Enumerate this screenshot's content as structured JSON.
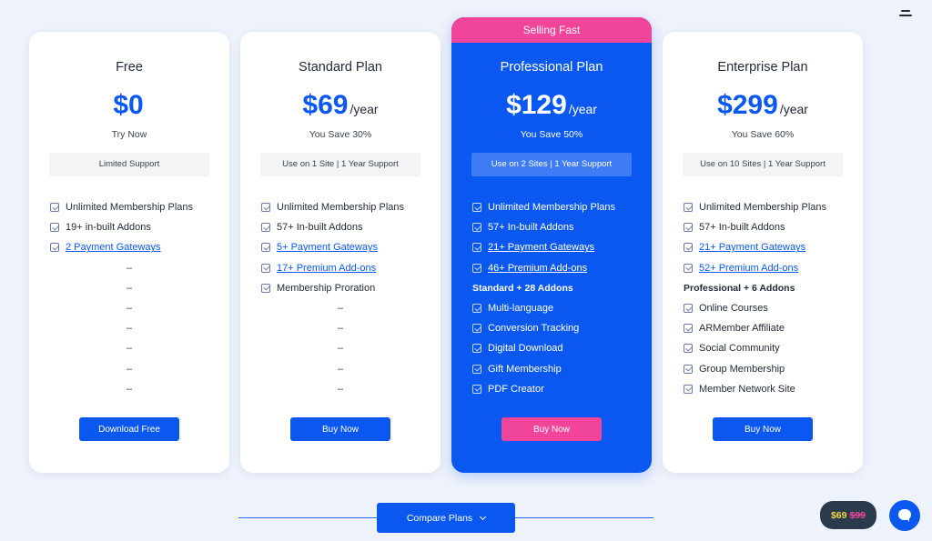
{
  "colors": {
    "primary": "#0a58f0",
    "accent": "#f0459a",
    "background": "#eef2fb"
  },
  "icons": {
    "menu": "menu-icon",
    "check": "check-icon",
    "chevron": "chevron-down-icon",
    "chat": "chat-icon"
  },
  "plans": [
    {
      "name": "Free",
      "price": "$0",
      "period": "",
      "subtext": "Try Now",
      "support": "Limited Support",
      "features": [
        {
          "text": "Unlimited Membership Plans"
        },
        {
          "text": "19+ in-built Addons"
        },
        {
          "text": "2 Payment Gateways",
          "link": true
        },
        {
          "text": "–"
        },
        {
          "text": "–"
        },
        {
          "text": "–"
        },
        {
          "text": "–"
        },
        {
          "text": "–"
        },
        {
          "text": "–"
        },
        {
          "text": "–"
        }
      ],
      "cta": "Download Free"
    },
    {
      "name": "Standard Plan",
      "price": "$69",
      "period": "/year",
      "subtext": "You Save 30%",
      "support": "Use on 1 Site | 1 Year Support",
      "features": [
        {
          "text": "Unlimited Membership Plans"
        },
        {
          "text": "57+ In-built Addons"
        },
        {
          "text": "5+ Payment Gateways",
          "link": true
        },
        {
          "text": "17+ Premium Add-ons",
          "link": true
        },
        {
          "text": "Membership Proration"
        },
        {
          "text": "–"
        },
        {
          "text": "–"
        },
        {
          "text": "–"
        },
        {
          "text": "–"
        },
        {
          "text": "–"
        }
      ],
      "cta": "Buy Now"
    },
    {
      "badge": "Selling Fast",
      "name": "Professional Plan",
      "price": "$129",
      "period": "/year",
      "subtext": "You Save 50%",
      "support": "Use on 2 Sites | 1 Year Support",
      "features": [
        {
          "text": "Unlimited Membership Plans"
        },
        {
          "text": "57+ In-built Addons"
        },
        {
          "text": "21+ Payment Gateways",
          "link": true
        },
        {
          "text": "46+ Premium Add-ons",
          "link": true
        },
        {
          "text": "Standard + 28 Addons",
          "heading": true
        },
        {
          "text": "Multi-language"
        },
        {
          "text": "Conversion Tracking"
        },
        {
          "text": "Digital Download"
        },
        {
          "text": "Gift Membership"
        },
        {
          "text": "PDF Creator"
        }
      ],
      "cta": "Buy Now"
    },
    {
      "name": "Enterprise Plan",
      "price": "$299",
      "period": "/year",
      "subtext": "You Save 60%",
      "support": "Use on 10 Sites | 1 Year Support",
      "features": [
        {
          "text": "Unlimited Membership Plans"
        },
        {
          "text": "57+ In-built Addons"
        },
        {
          "text": "21+ Payment Gateways",
          "link": true
        },
        {
          "text": "52+ Premium Add-ons",
          "link": true
        },
        {
          "text": "Professional + 6 Addons",
          "heading": true
        },
        {
          "text": "Online Courses"
        },
        {
          "text": "ARMember Affiliate"
        },
        {
          "text": "Social Community"
        },
        {
          "text": "Group Membership"
        },
        {
          "text": "Member Network Site"
        }
      ],
      "cta": "Buy Now"
    }
  ],
  "compare_button": "Compare Plans",
  "promo": {
    "new_price": "$69",
    "old_price": "$99"
  }
}
